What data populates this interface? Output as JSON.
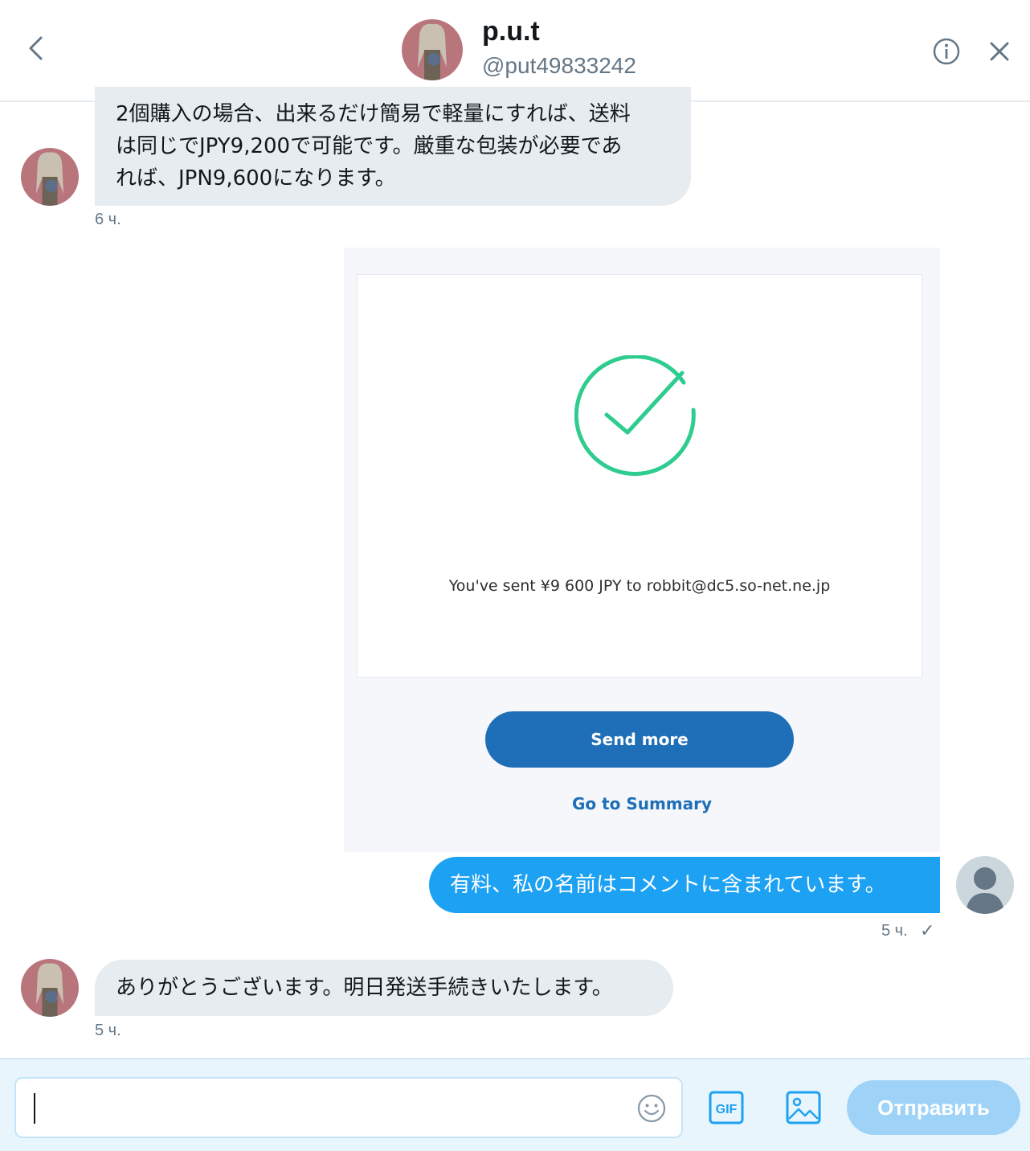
{
  "header": {
    "display_name": "p.u.t",
    "screen_name": "@put49833242"
  },
  "messages": [
    {
      "direction": "incoming",
      "lines": [
        "2個購入の場合、出来るだけ簡易で軽量にすれば、送料",
        "は同じでJPY9,200で可能です。厳重な包装が必要であ",
        "れば、JPN9,600になります。"
      ],
      "time": "6 ч."
    },
    {
      "direction": "outgoing",
      "attachment": {
        "text": "You've sent ¥9 600 JPY to robbit@dc5.so-net.ne.jp",
        "primary_button": "Send more",
        "secondary_link": "Go to Summary",
        "check_color": "#2ecc8f"
      },
      "text": "有料、私の名前はコメントに含まれています。",
      "time": "5 ч.",
      "status_mark": "✓"
    },
    {
      "direction": "incoming",
      "text": "ありがとうございます。明日発送手続きいたします。",
      "time": "5 ч."
    }
  ],
  "composer": {
    "input_value": "",
    "gif_label": "GIF",
    "send_label": "Отправить"
  },
  "colors": {
    "accent": "#1da1f2",
    "incoming_bubble": "#e6ecf0",
    "paypal_blue": "#1e6fb8"
  }
}
